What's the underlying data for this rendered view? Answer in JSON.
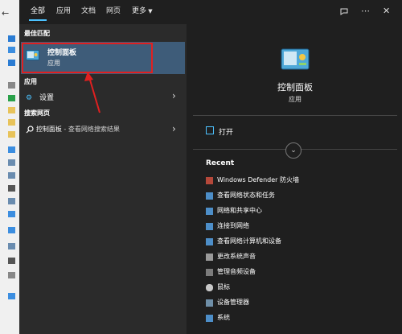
{
  "tabs": [
    "全部",
    "应用",
    "文档",
    "网页",
    "更多"
  ],
  "topbar_icons": [
    "feedback-icon",
    "more-icon",
    "close-icon"
  ],
  "glyphs": {
    "more": "⋯",
    "close": "✕",
    "chevron": "›",
    "expand": "⌄",
    "back": "←"
  },
  "left": {
    "best_match_header": "最佳匹配",
    "best_match": {
      "title": "控制面板",
      "subtitle": "应用",
      "icon": "control-panel-icon"
    },
    "apps_header": "应用",
    "settings_label": "设置",
    "web_header": "搜索网页",
    "web_search": {
      "term": "控制面板",
      "suffix": " - 查看网络搜索结果"
    }
  },
  "right": {
    "title": "控制面板",
    "subtitle": "应用",
    "open_label": "打开",
    "recent_header": "Recent",
    "recent": [
      {
        "label": "Windows Defender 防火墙",
        "icon": "firewall-icon"
      },
      {
        "label": "查看网络状态和任务",
        "icon": "network-icon"
      },
      {
        "label": "网络和共享中心",
        "icon": "network-icon"
      },
      {
        "label": "连接到网络",
        "icon": "network-icon"
      },
      {
        "label": "查看网络计算机和设备",
        "icon": "network-icon"
      },
      {
        "label": "更改系统声音",
        "icon": "speaker-icon"
      },
      {
        "label": "管理音频设备",
        "icon": "audio-device-icon"
      },
      {
        "label": "鼠标",
        "icon": "mouse-icon"
      },
      {
        "label": "设备管理器",
        "icon": "device-manager-icon"
      },
      {
        "label": "系统",
        "icon": "system-icon"
      }
    ]
  },
  "colors": {
    "accent": "#4cc2ff",
    "highlight": "#3e5c79",
    "annotation": "#e02020"
  }
}
